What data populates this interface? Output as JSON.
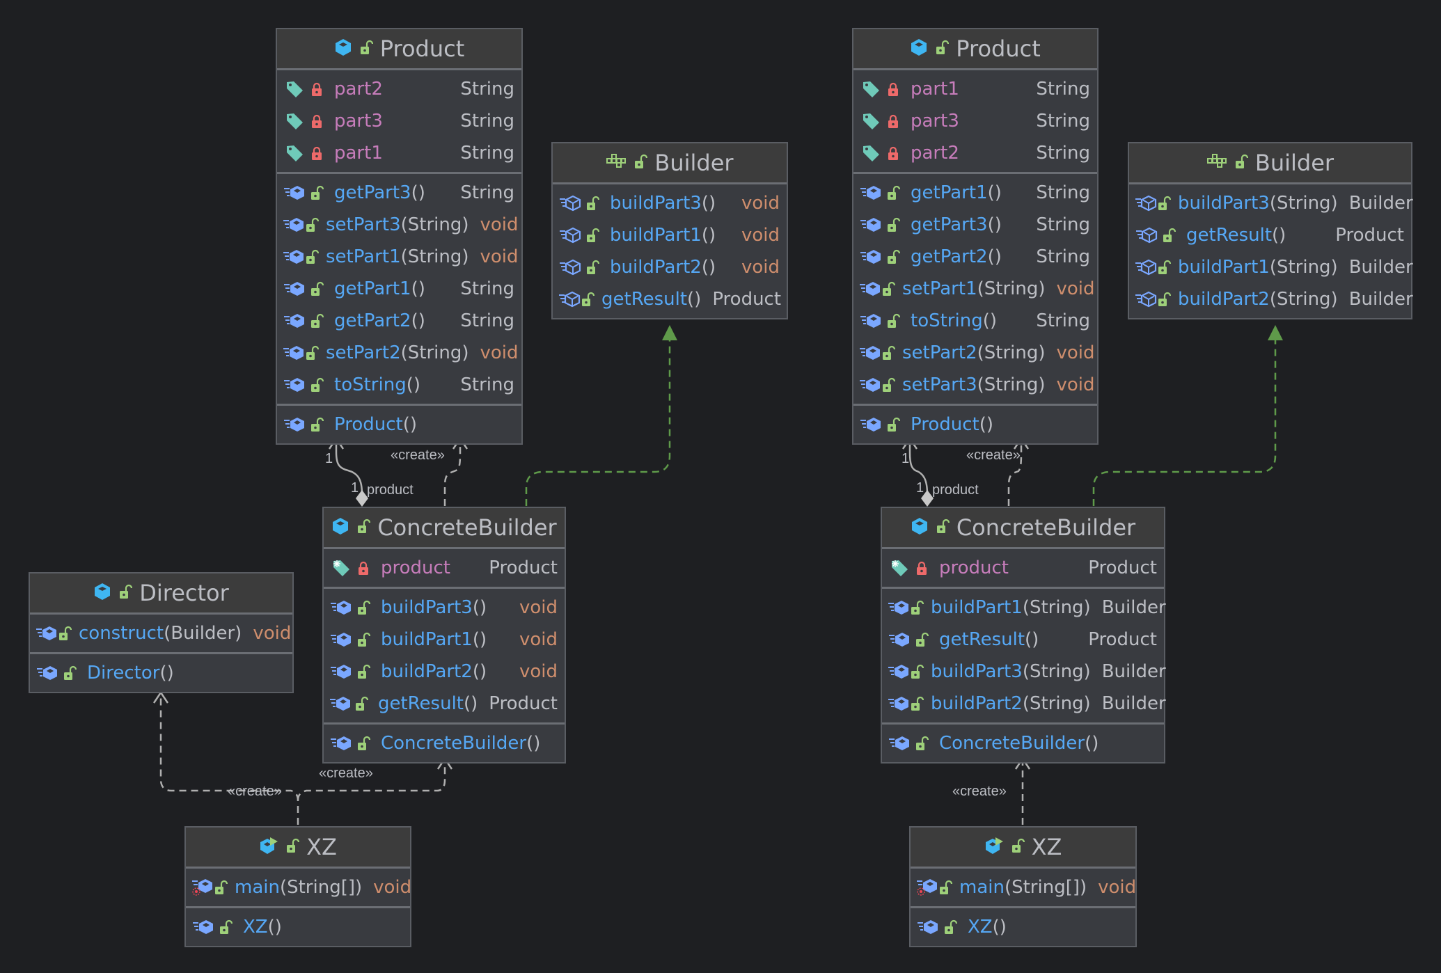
{
  "colors": {
    "background": "#1e1f22",
    "box_fill": "#393b40",
    "header_fill": "#3c3c3c",
    "method_name": "#56a8f5",
    "field_name": "#c77dbb",
    "type_text": "#bcbec4",
    "void_type": "#cf8e6d",
    "realization_arrow": "#5f9a4a",
    "dependency_arrow": "#b0b0b0"
  },
  "left": {
    "product": {
      "title": "Product",
      "icon": "class-icon",
      "fields": [
        {
          "name": "part2",
          "type": "String"
        },
        {
          "name": "part3",
          "type": "String"
        },
        {
          "name": "part1",
          "type": "String"
        }
      ],
      "methods": [
        {
          "name": "getPart3",
          "args": "()",
          "type": "String"
        },
        {
          "name": "setPart3",
          "args": "(String)",
          "type": "void"
        },
        {
          "name": "setPart1",
          "args": "(String)",
          "type": "void"
        },
        {
          "name": "getPart1",
          "args": "()",
          "type": "String"
        },
        {
          "name": "getPart2",
          "args": "()",
          "type": "String"
        },
        {
          "name": "setPart2",
          "args": "(String)",
          "type": "void"
        },
        {
          "name": "toString",
          "args": "()",
          "type": "String"
        }
      ],
      "constructors": [
        {
          "name": "Product",
          "args": "()"
        }
      ]
    },
    "builder": {
      "title": "Builder",
      "icon": "abstract-class-icon",
      "methods": [
        {
          "name": "buildPart3",
          "args": "()",
          "type": "void"
        },
        {
          "name": "buildPart1",
          "args": "()",
          "type": "void"
        },
        {
          "name": "buildPart2",
          "args": "()",
          "type": "void"
        },
        {
          "name": "getResult",
          "args": "()",
          "type": "Product"
        }
      ]
    },
    "concrete_builder": {
      "title": "ConcreteBuilder",
      "icon": "class-icon",
      "fields": [
        {
          "name": "product",
          "type": "Product"
        }
      ],
      "methods": [
        {
          "name": "buildPart3",
          "args": "()",
          "type": "void"
        },
        {
          "name": "buildPart1",
          "args": "()",
          "type": "void"
        },
        {
          "name": "buildPart2",
          "args": "()",
          "type": "void"
        },
        {
          "name": "getResult",
          "args": "()",
          "type": "Product"
        }
      ],
      "constructors": [
        {
          "name": "ConcreteBuilder",
          "args": "()"
        }
      ]
    },
    "director": {
      "title": "Director",
      "icon": "class-icon",
      "methods": [
        {
          "name": "construct",
          "args": "(Builder)",
          "type": "void"
        }
      ],
      "constructors": [
        {
          "name": "Director",
          "args": "()"
        }
      ]
    },
    "xz": {
      "title": "XZ",
      "icon": "runnable-class-icon",
      "methods": [
        {
          "name": "main",
          "args": "(String[])",
          "type": "void"
        }
      ],
      "constructors": [
        {
          "name": "XZ",
          "args": "()"
        }
      ]
    },
    "labels": {
      "create1": "«create»",
      "mult_product": "1",
      "mult_builder": "1",
      "role": "product",
      "create_director": "«create»",
      "create_cb": "«create»"
    }
  },
  "right": {
    "product": {
      "title": "Product",
      "icon": "class-icon",
      "fields": [
        {
          "name": "part1",
          "type": "String"
        },
        {
          "name": "part3",
          "type": "String"
        },
        {
          "name": "part2",
          "type": "String"
        }
      ],
      "methods": [
        {
          "name": "getPart1",
          "args": "()",
          "type": "String"
        },
        {
          "name": "getPart3",
          "args": "()",
          "type": "String"
        },
        {
          "name": "getPart2",
          "args": "()",
          "type": "String"
        },
        {
          "name": "setPart1",
          "args": "(String)",
          "type": "void"
        },
        {
          "name": "toString",
          "args": "()",
          "type": "String"
        },
        {
          "name": "setPart2",
          "args": "(String)",
          "type": "void"
        },
        {
          "name": "setPart3",
          "args": "(String)",
          "type": "void"
        }
      ],
      "constructors": [
        {
          "name": "Product",
          "args": "()"
        }
      ]
    },
    "builder": {
      "title": "Builder",
      "icon": "abstract-class-icon",
      "methods": [
        {
          "name": "buildPart3",
          "args": "(String)",
          "type": "Builder"
        },
        {
          "name": "getResult",
          "args": "()",
          "type": "Product"
        },
        {
          "name": "buildPart1",
          "args": "(String)",
          "type": "Builder"
        },
        {
          "name": "buildPart2",
          "args": "(String)",
          "type": "Builder"
        }
      ]
    },
    "concrete_builder": {
      "title": "ConcreteBuilder",
      "icon": "class-icon",
      "fields": [
        {
          "name": "product",
          "type": "Product"
        }
      ],
      "methods": [
        {
          "name": "buildPart1",
          "args": "(String)",
          "type": "Builder"
        },
        {
          "name": "getResult",
          "args": "()",
          "type": "Product"
        },
        {
          "name": "buildPart3",
          "args": "(String)",
          "type": "Builder"
        },
        {
          "name": "buildPart2",
          "args": "(String)",
          "type": "Builder"
        }
      ],
      "constructors": [
        {
          "name": "ConcreteBuilder",
          "args": "()"
        }
      ]
    },
    "xz": {
      "title": "XZ",
      "icon": "runnable-class-icon",
      "methods": [
        {
          "name": "main",
          "args": "(String[])",
          "type": "void"
        }
      ],
      "constructors": [
        {
          "name": "XZ",
          "args": "()"
        }
      ]
    },
    "labels": {
      "create1": "«create»",
      "mult_product": "1",
      "mult_builder": "1",
      "role": "product",
      "create_cb": "«create»"
    }
  }
}
